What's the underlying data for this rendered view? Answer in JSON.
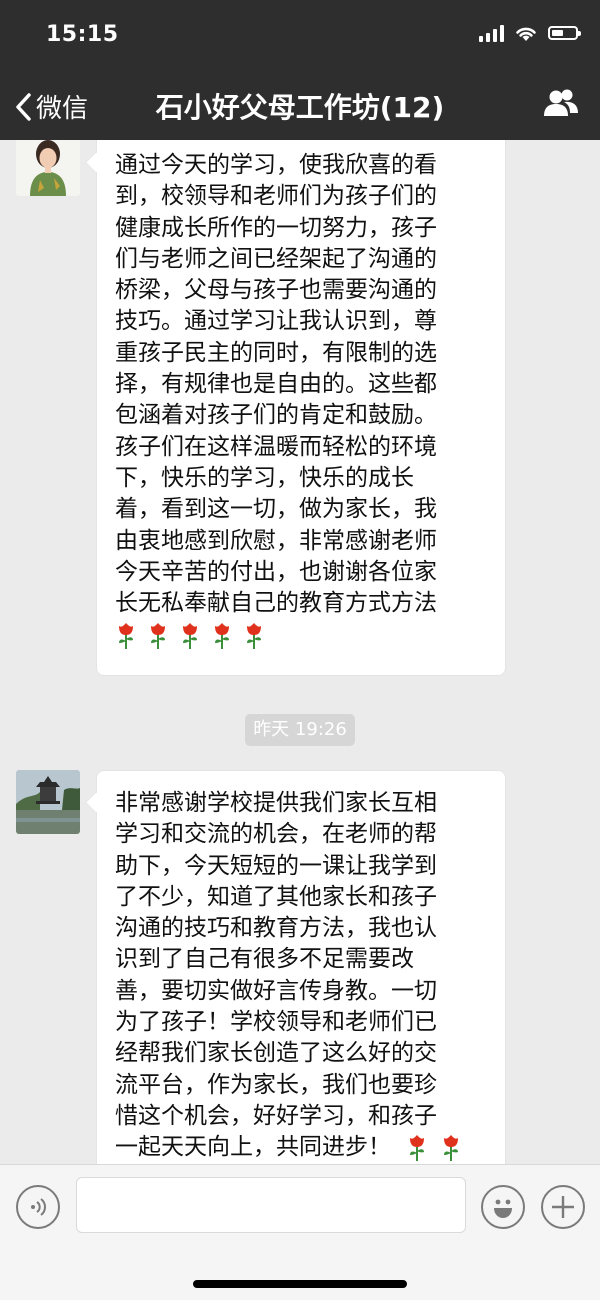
{
  "status_bar": {
    "time": "15:15"
  },
  "nav": {
    "back_label": "微信",
    "title": "石小好父母工作坊(12)"
  },
  "messages": [
    {
      "lines": [
        "通过今天的学习，使我欣喜的看",
        "到，校领导和老师们为孩子们的",
        "健康成长所作的一切努力，孩子",
        "们与老师之间已经架起了沟通的",
        "桥梁，父母与孩子也需要沟通的",
        "技巧。通过学习让我认识到，尊",
        "重孩子民主的同时，有限制的选",
        "择，有规律也是自由的。这些都",
        "包涵着对孩子们的肯定和鼓励。",
        "孩子们在这样温暖而轻松的环境",
        "下，快乐的学习，快乐的成长",
        "着，看到这一切，做为家长，我",
        "由衷地感到欣慰，非常感谢老师",
        "今天辛苦的付出，也谢谢各位家",
        "长无私奉献自己的教育方式方法"
      ],
      "emoji": [
        "rose-icon",
        "rose-icon",
        "rose-icon",
        "rose-icon",
        "rose-icon"
      ]
    },
    {
      "lines": [
        "非常感谢学校提供我们家长互相",
        "学习和交流的机会，在老师的帮",
        "助下，今天短短的一课让我学到",
        "了不少，知道了其他家长和孩子",
        "沟通的技巧和教育方法，我也认",
        "识到了自己有很多不足需要改",
        "善，要切实做好言传身教。一切",
        "为了孩子！学校领导和老师们已",
        "经帮我们家长创造了这么好的交",
        "流平台，作为家长，我们也要珍",
        "惜这个机会，好好学习，和孩子",
        "一起天天向上，共同进步！"
      ],
      "emoji": [
        "rose-icon",
        "rose-icon"
      ]
    }
  ],
  "timestamp": "昨天 19:26",
  "colors": {
    "nav_bg": "#2e2e2e",
    "chat_bg": "#ebebeb",
    "bubble_bg": "#ffffff",
    "rose_red": "#e0311d",
    "rose_green": "#3a8f3a"
  }
}
